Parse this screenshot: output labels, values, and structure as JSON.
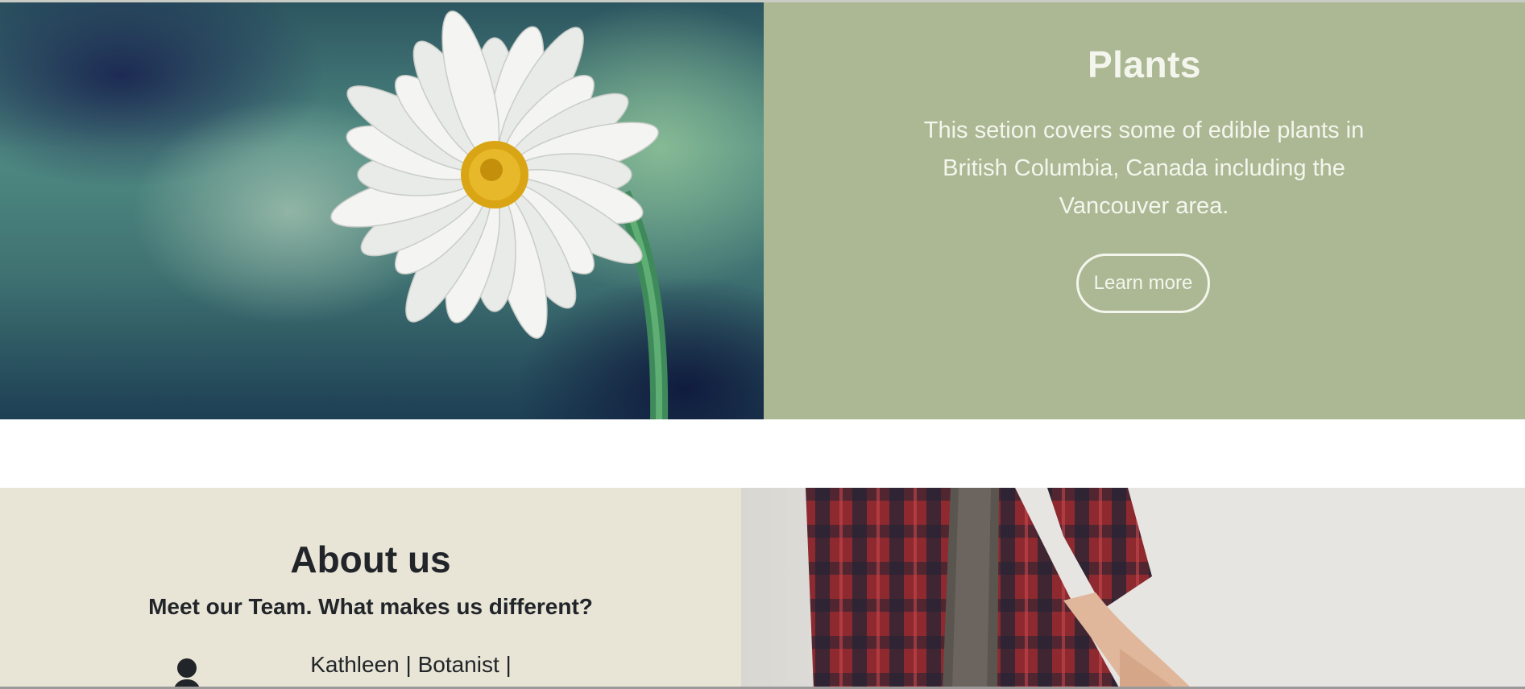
{
  "plants": {
    "title": "Plants",
    "description": "This setion covers some of edible plants in British Columbia, Canada including the Vancouver area.",
    "button_label": "Learn more",
    "panel_color": "#abb893"
  },
  "about": {
    "title": "About us",
    "subtitle": "Meet our Team. What makes us different?",
    "member_line": "Kathleen | Botanist |",
    "panel_color": "#e8e4d6",
    "member_icon": "person-icon"
  }
}
